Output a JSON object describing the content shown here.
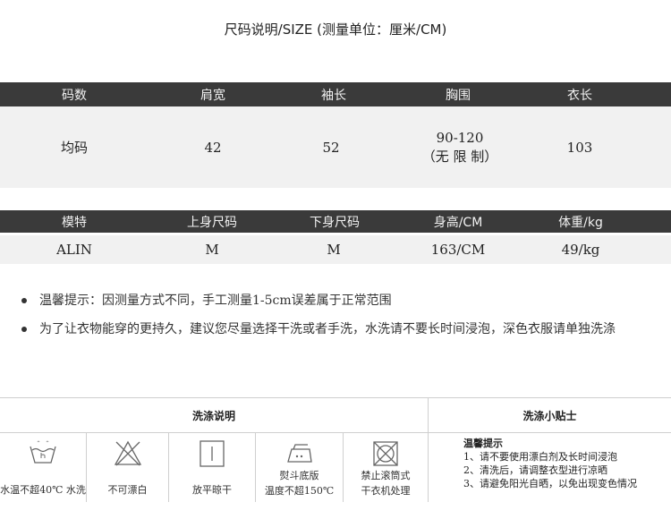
{
  "title": "尺码说明/SIZE (测量单位：厘米/CM)",
  "size_table": {
    "headers": [
      "码数",
      "肩宽",
      "袖长",
      "胸围",
      "衣长"
    ],
    "row": {
      "size": "均码",
      "shoulder": "42",
      "sleeve": "52",
      "chest_value": "90-120",
      "chest_note": "（无 限 制）",
      "length": "103"
    }
  },
  "model_table": {
    "headers": [
      "模特",
      "上身尺码",
      "下身尺码",
      "身高/CM",
      "体重/kg"
    ],
    "row": [
      "ALIN",
      "M",
      "M",
      "163/CM",
      "49/kg"
    ]
  },
  "notes": [
    "温馨提示：因测量方式不同，手工测量1-5cm误差属于正常范围",
    "为了让衣物能穿的更持久，建议您尽量选择干洗或者手洗，水洗请不要长时间浸泡，深色衣服请单独洗涤"
  ],
  "care": {
    "left_header": "洗涤说明",
    "right_header": "洗涤小贴士",
    "icons": [
      {
        "icon": "wash-basin-icon",
        "label": "水温不超40℃ 水洗"
      },
      {
        "icon": "no-bleach-icon",
        "label": "不可漂白"
      },
      {
        "icon": "dry-flat-icon",
        "label": "放平晾干"
      },
      {
        "icon": "iron-icon",
        "label_line1": "熨斗底版",
        "label_line2": "温度不超150℃"
      },
      {
        "icon": "no-tumble-dry-icon",
        "label_line1": "禁止滚筒式",
        "label_line2": "干衣机处理"
      }
    ],
    "tips_title": "温馨提示",
    "tips": [
      "1、请不要使用漂白剂及长时间浸泡",
      "2、清洗后，请调整衣型进行凉晒",
      "3、请避免阳光自晒，以免出现变色情况"
    ]
  }
}
